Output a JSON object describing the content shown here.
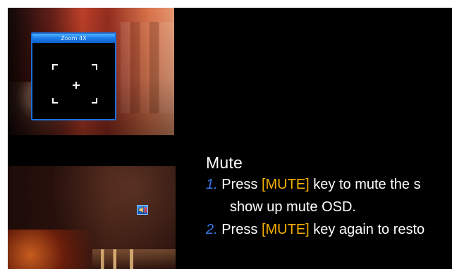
{
  "zoom_osd": {
    "title": "Zoom 4X"
  },
  "section": {
    "title": "Mute",
    "steps": [
      {
        "number": "1.",
        "prefix": "Press",
        "key": "[MUTE]",
        "text": "key to mute the s"
      },
      {
        "continuation": "show up mute OSD."
      },
      {
        "number": "2.",
        "prefix": "Press",
        "key": "[MUTE]",
        "text": "key again to resto"
      }
    ]
  },
  "colors": {
    "number_blue": "#3a78e6",
    "key_gold": "#f5b000",
    "osd_blue": "#1b7ae8"
  }
}
